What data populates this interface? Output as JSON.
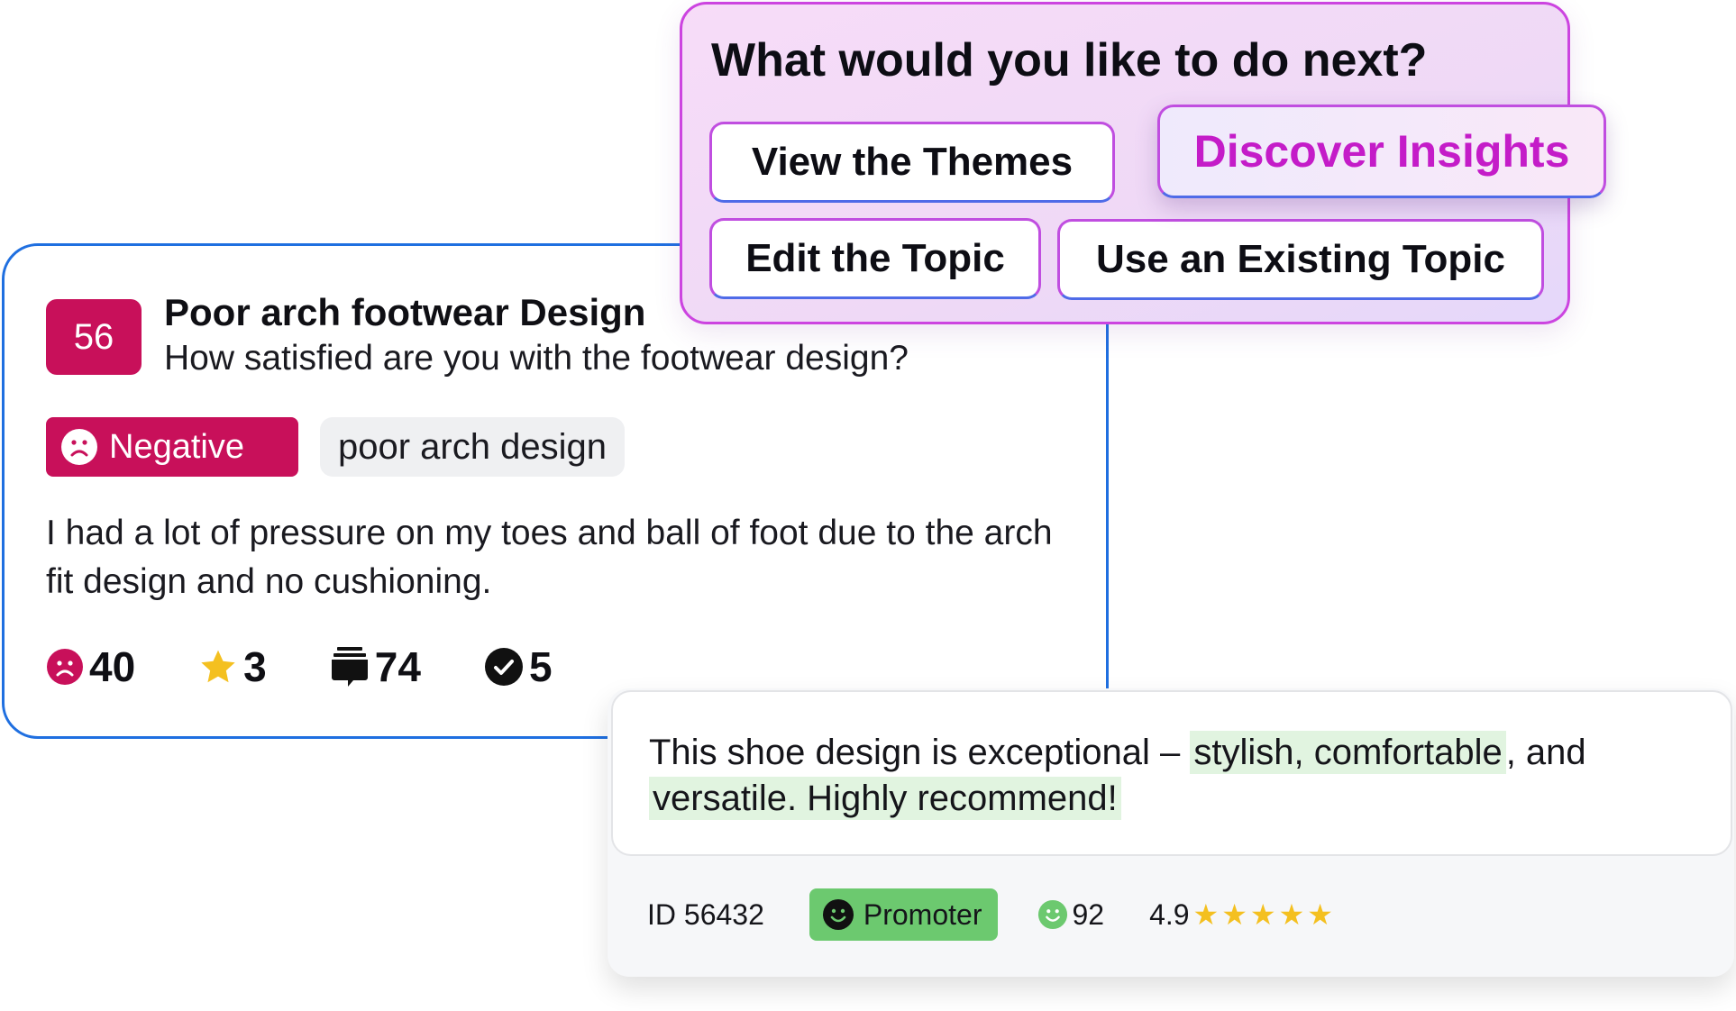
{
  "topic_card": {
    "score": "56",
    "title": "Poor arch footwear Design",
    "question": "How satisfied are you with the footwear design?",
    "sentiment_label": "Negative",
    "tag": "poor arch design",
    "comment": "I had a lot of pressure on my toes and ball of foot due to the arch fit design and no cushioning.",
    "metrics": [
      {
        "icon": "frown-face-icon",
        "value": "40"
      },
      {
        "icon": "star-icon",
        "value": "3"
      },
      {
        "icon": "comment-stack-icon",
        "value": "74"
      },
      {
        "icon": "check-circle-icon",
        "value": "5"
      }
    ],
    "colors": {
      "border": "#1f6fe0",
      "negative": "#c8105a"
    }
  },
  "action_panel": {
    "title": "What would you like to do next?",
    "actions": {
      "view_themes": "View the Themes",
      "discover_insights": "Discover Insights",
      "edit_topic": "Edit the Topic",
      "use_existing_topic": "Use an Existing Topic"
    },
    "colors": {
      "accent": "#c41cc8",
      "border": "#cc44e0"
    }
  },
  "review_card": {
    "text_plain_1": "This shoe design is exceptional – ",
    "text_highlight_1": "stylish, comfortable",
    "text_plain_2": ", and ",
    "text_highlight_2": "versatile. Highly recommend!",
    "id_label": "ID 56432",
    "badge": "Promoter",
    "nps_score": "92",
    "rating": "4.9",
    "star_count": 5,
    "colors": {
      "promoter": "#6cc96f",
      "highlight": "#e1f4e0",
      "star": "#f4c020"
    }
  }
}
